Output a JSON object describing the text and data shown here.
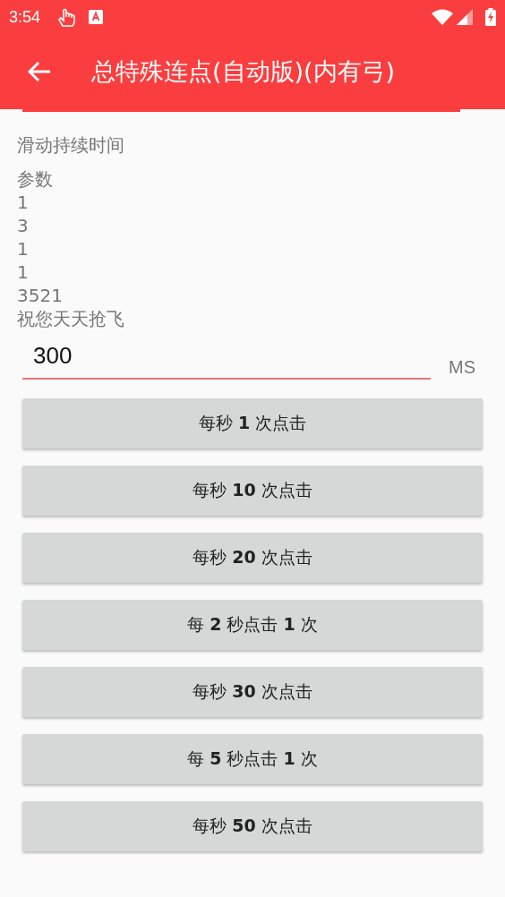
{
  "status_bar": {
    "time": "3:54"
  },
  "app_bar": {
    "title": "总特殊连点(自动版)(内有弓)"
  },
  "info_lines": [
    "滑动持续时间",
    "参数",
    "1",
    "3",
    "1",
    "1",
    "3521",
    "祝您天天抢飞"
  ],
  "duration_field": {
    "value": "300",
    "unit": "MS"
  },
  "buttons": [
    {
      "label": "每秒 **1** 次点击"
    },
    {
      "label": "每秒 **10** 次点击"
    },
    {
      "label": "每秒 **20** 次点击"
    },
    {
      "label": "每 **2** 秒点击 **1** 次"
    },
    {
      "label": "每秒 **30** 次点击"
    },
    {
      "label": "每 **5** 秒点击 **1** 次"
    },
    {
      "label": "每秒 **50** 次点击"
    }
  ]
}
